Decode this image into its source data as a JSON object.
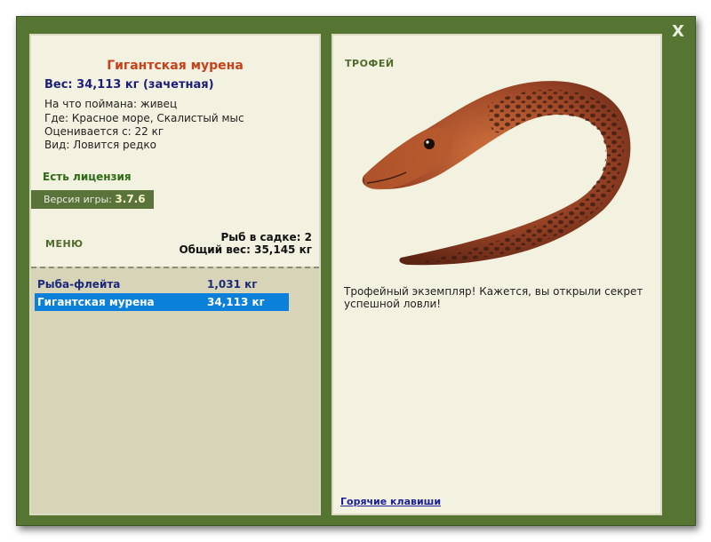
{
  "window": {
    "close_label": "X"
  },
  "fish": {
    "name": "Гигантская мурена",
    "weight_line": "Вес: 34,113 кг (зачетная)",
    "info": [
      "На что поймана: живец",
      "Где: Красное море, Скалистый мыс",
      "Оценивается с: 22 кг",
      "Вид: Ловится редко"
    ]
  },
  "license": "Есть лицензия",
  "version": {
    "label": "Версия игры:",
    "value": "3.7.6"
  },
  "menu": {
    "title": "МЕНЮ",
    "fish_count": "Рыб в садке: 2",
    "total_weight": "Общий вес: 35,145 кг"
  },
  "catches": [
    {
      "name": "Рыба-флейта",
      "weight": "1,031 кг",
      "selected": false
    },
    {
      "name": "Гигантская мурена",
      "weight": "34,113 кг",
      "selected": true
    }
  ],
  "trophy": {
    "title": "ТРОФЕЙ",
    "description": "Трофейный экземпляр! Кажется, вы открыли секрет успешной ловли!"
  },
  "hotkeys_link": "Горячие клавиши",
  "colors": {
    "frame": "#567432",
    "panel": "#f3f1df",
    "list_bg": "#d7d4b7",
    "fish_name": "#c4421b",
    "selected_row": "#0a80db"
  }
}
